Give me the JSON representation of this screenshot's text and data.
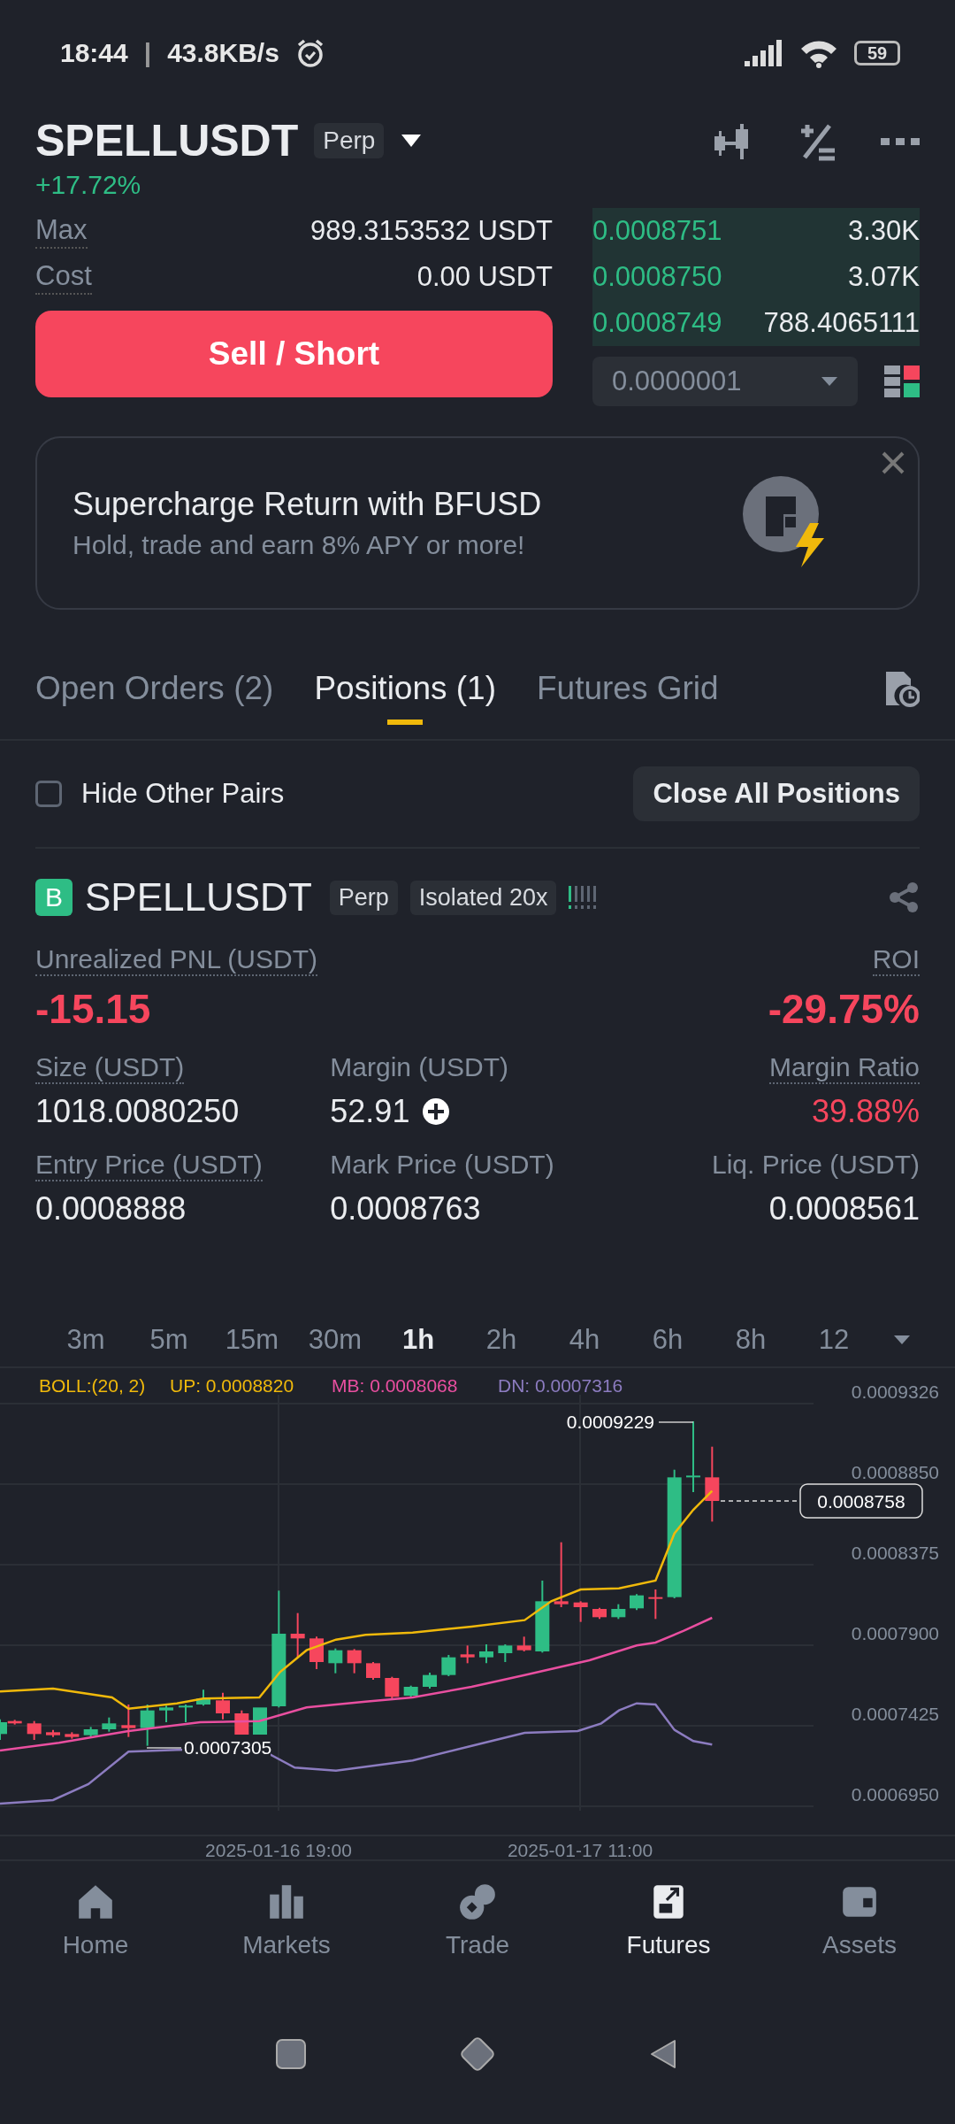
{
  "status_bar": {
    "time": "18:44",
    "separator": "|",
    "speed": "43.8KB/s",
    "battery": "59"
  },
  "header": {
    "symbol": "SPELLUSDT",
    "tag": "Perp",
    "change": "+17.72%"
  },
  "order_form": {
    "rows": [
      {
        "label": "Max",
        "value": "989.3153532 USDT"
      },
      {
        "label": "Cost",
        "value": "0.00 USDT"
      }
    ],
    "sell_button": "Sell / Short"
  },
  "order_book": {
    "rows": [
      {
        "price": "0.0008751",
        "amount": "3.30K"
      },
      {
        "price": "0.0008750",
        "amount": "3.07K"
      },
      {
        "price": "0.0008749",
        "amount": "788.4065111"
      }
    ],
    "tick_size": "0.0000001"
  },
  "banner": {
    "title": "Supercharge Return with BFUSD",
    "subtitle": "Hold, trade and earn 8% APY or more!"
  },
  "tabs": [
    {
      "label": "Open Orders (2)",
      "selected": false
    },
    {
      "label": "Positions (1)",
      "selected": true
    },
    {
      "label": "Futures Grid",
      "selected": false
    }
  ],
  "filter": {
    "label": "Hide Other Pairs",
    "checked": false,
    "close_all": "Close All Positions"
  },
  "position": {
    "side": "B",
    "symbol": "SPELLUSDT",
    "tags": [
      "Perp",
      "Isolated 20x"
    ],
    "risk_bars": [
      {
        "lit": true
      },
      {
        "lit": false
      },
      {
        "lit": false
      },
      {
        "lit": false
      },
      {
        "lit": false
      }
    ],
    "fields": [
      {
        "label": "Unrealized PNL (USDT)",
        "value": "-15.15",
        "negative": true,
        "dotted": true,
        "kind": "big"
      },
      {
        "label": "ROI",
        "value": "-29.75%",
        "negative": true,
        "dotted": true,
        "kind": "big"
      },
      {
        "label": "Size (USDT)",
        "value": "1018.0080250",
        "negative": false,
        "dotted": true,
        "kind": "plain"
      },
      {
        "label": "Margin (USDT)",
        "value": "52.91",
        "negative": false,
        "dotted": false,
        "kind": "add"
      },
      {
        "label": "Margin Ratio",
        "value": "39.88%",
        "negative": true,
        "dotted": true,
        "kind": "plain"
      },
      {
        "label": "Entry Price (USDT)",
        "value": "0.0008888",
        "negative": false,
        "dotted": true,
        "kind": "plain"
      },
      {
        "label": "Mark Price (USDT)",
        "value": "0.0008763",
        "negative": false,
        "dotted": false,
        "kind": "plain"
      },
      {
        "label": "Liq. Price (USDT)",
        "value": "0.0008561",
        "negative": false,
        "dotted": false,
        "kind": "plain"
      }
    ]
  },
  "chart": {
    "intervals": [
      {
        "label": "3m",
        "selected": false
      },
      {
        "label": "5m",
        "selected": false
      },
      {
        "label": "15m",
        "selected": false
      },
      {
        "label": "30m",
        "selected": false
      },
      {
        "label": "1h",
        "selected": true
      },
      {
        "label": "2h",
        "selected": false
      },
      {
        "label": "4h",
        "selected": false
      },
      {
        "label": "6h",
        "selected": false
      },
      {
        "label": "8h",
        "selected": false
      },
      {
        "label": "12",
        "selected": false
      }
    ],
    "indicator": {
      "name": "BOLL:(20, 2)",
      "up": "UP: 0.0008820",
      "mb": "MB: 0.0008068",
      "dn": "DN: 0.0007316"
    },
    "price_labels": [
      "0.0009326",
      "0.0008850",
      "0.0008375",
      "0.0007900",
      "0.0007425",
      "0.0006950"
    ],
    "time_labels": [
      "2025-01-16 19:00",
      "2025-01-17 11:00"
    ],
    "high_label": "0.0009229",
    "low_label": "0.0007305",
    "last_price": "0.0008758"
  },
  "bottom_nav": [
    {
      "label": "Home",
      "selected": false
    },
    {
      "label": "Markets",
      "selected": false
    },
    {
      "label": "Trade",
      "selected": false
    },
    {
      "label": "Futures",
      "selected": true
    },
    {
      "label": "Assets",
      "selected": false
    }
  ]
}
